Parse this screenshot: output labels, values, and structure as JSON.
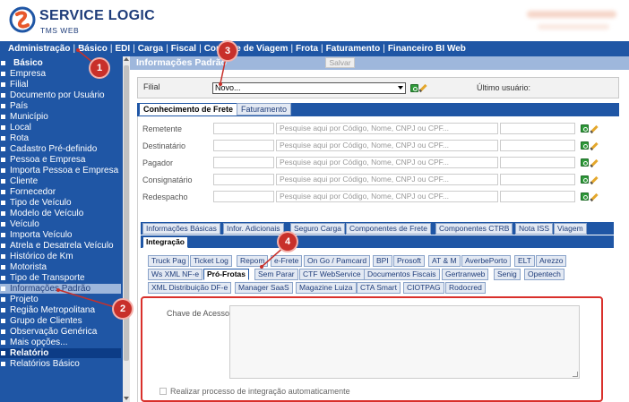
{
  "brand": {
    "name": "SERVICE LOGIC",
    "sub": "TMS WEB"
  },
  "topmenu": [
    "Administração",
    "Básico",
    "EDI",
    "Carga",
    "Fiscal",
    "Controle de Viagem",
    "Frota",
    "Faturamento",
    "Financeiro BI Web"
  ],
  "sidebar": {
    "heading": "Básico",
    "items": [
      "Empresa",
      "Filial",
      "Documento por Usuário",
      "País",
      "Município",
      "Local",
      "Rota",
      "Cadastro Pré-definido",
      "Pessoa e Empresa",
      "Importa Pessoa e Empresa",
      "Cliente",
      "Fornecedor",
      "Tipo de Veículo",
      "Modelo de Veículo",
      "Veículo",
      "Importa Veículo",
      "Atrela e Desatrela Veículo",
      "Histórico de Km",
      "Motorista",
      "Tipo de Transporte",
      "Informações Padrão",
      "Projeto",
      "Região Metropolitana",
      "Grupo de Clientes",
      "Observação Genérica",
      "Mais opções..."
    ],
    "selected": "Informações Padrão",
    "footer": [
      "Relatório",
      "Relatórios Básico"
    ]
  },
  "main": {
    "title": "Informações Padrão",
    "save_label": "Salvar",
    "filial_label": "Filial",
    "filial_value": "Novo...",
    "last_user_label": "Último usuário:"
  },
  "tabs_top": [
    "Conhecimento de Frete",
    "Faturamento"
  ],
  "form_rows": [
    {
      "label": "Remetente",
      "placeholder": "Pesquise aqui por Código, Nome, CNPJ ou CPF..."
    },
    {
      "label": "Destinatário",
      "placeholder": "Pesquise aqui por Código, Nome, CNPJ ou CPF..."
    },
    {
      "label": "Pagador",
      "placeholder": "Pesquise aqui por Código, Nome, CNPJ ou CPF..."
    },
    {
      "label": "Consignatário",
      "placeholder": "Pesquise aqui por Código, Nome, CNPJ ou CPF..."
    },
    {
      "label": "Redespacho",
      "placeholder": "Pesquise aqui por Código, Nome, CNPJ ou CPF..."
    }
  ],
  "tabs2_row1": [
    "Informações Básicas",
    "Infor. Adicionais",
    "Seguro Carga",
    "Componentes de Frete",
    "Componentes CTRB",
    "Nota ISS",
    "Viagem"
  ],
  "tabs2_row2": [
    "Integração"
  ],
  "tabs3_row1": [
    "Truck Pag",
    "Ticket Log",
    "Repom",
    "e-Frete",
    "On Go / Pamcard",
    "BPI",
    "Prosoft",
    "AT & M",
    "AverbePorto",
    "ELT",
    "Arezzo"
  ],
  "tabs3_row2": [
    "Ws XML NF-e",
    "Pró-Frotas",
    "Sem Parar",
    "CTF WebService",
    "Documentos Fiscais",
    "Gertranweb",
    "Senig",
    "Opentech"
  ],
  "tabs3_row3": [
    "XML Distribuição DF-e",
    "Manager SaaS",
    "Magazine Luiza",
    "CTA Smart",
    "CIOTPAG",
    "Rodocred"
  ],
  "integration": {
    "access_key_label": "Chave de Acesso",
    "auto_label": "Realizar processo de integração automaticamente"
  },
  "annotations": [
    "1",
    "2",
    "3",
    "4"
  ],
  "colors": {
    "nav": "#1f56a5",
    "highlight": "#9eb7dc",
    "annotation": "#c8302a"
  }
}
